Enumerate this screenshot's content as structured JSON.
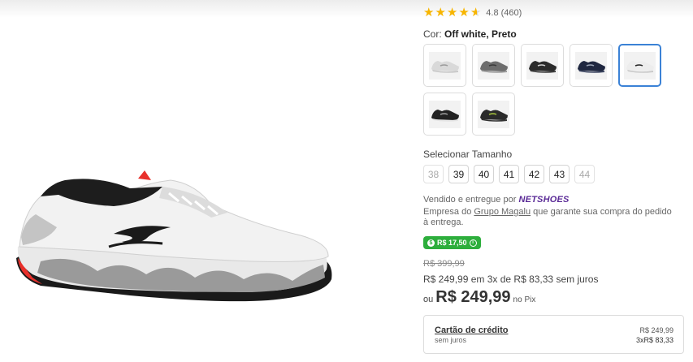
{
  "rating": {
    "value_text": "4.8 (460)",
    "stars": 4.5
  },
  "color": {
    "label": "Cor:",
    "value": "Off white, Preto"
  },
  "swatches": [
    {
      "name": "Off white, Cinza",
      "body": "#d9d9d9",
      "accent": "#9a9a9a",
      "sole": "#c8c8c8"
    },
    {
      "name": "Cinza escuro",
      "body": "#6d6d6d",
      "accent": "#3a3a3a",
      "sole": "#9a9a9a"
    },
    {
      "name": "Preto",
      "body": "#2b2b2b",
      "accent": "#cfcfcf",
      "sole": "#3a3a3a"
    },
    {
      "name": "Azul marinho",
      "body": "#1f2740",
      "accent": "#9aa3b5",
      "sole": "#3b4460"
    },
    {
      "name": "Off white, Preto",
      "body": "#ededed",
      "accent": "#222222",
      "sole": "#c9c9c9"
    },
    {
      "name": "Preto, Branco",
      "body": "#222222",
      "accent": "#9e9e9e",
      "sole": "#e6e6e6"
    },
    {
      "name": "Preto, Verde",
      "body": "#2a2a2a",
      "accent": "#a7c43d",
      "sole": "#333333"
    }
  ],
  "size_label": "Selecionar Tamanho",
  "sizes": [
    {
      "label": "38",
      "available": false
    },
    {
      "label": "39",
      "available": true
    },
    {
      "label": "40",
      "available": true
    },
    {
      "label": "41",
      "available": true
    },
    {
      "label": "42",
      "available": true
    },
    {
      "label": "43",
      "available": true
    },
    {
      "label": "44",
      "available": false
    }
  ],
  "seller": {
    "prefix": "Vendido e entregue por",
    "brand": "NETSHOES",
    "empresa_pre": "Empresa do",
    "empresa_link": "Grupo Magalu",
    "empresa_post": "que garante sua compra do pedido à entrega."
  },
  "cashback": {
    "text": "R$ 17,50",
    "icon": "cashback-icon",
    "info_icon": "info-icon"
  },
  "prices": {
    "old": "R$ 399,99",
    "installments": "R$ 249,99 em 3x de R$ 83,33 sem juros",
    "pix_prefix": "ou",
    "pix_price": "R$ 249,99",
    "pix_suffix": "no Pix"
  },
  "card": {
    "title": "Cartão de crédito",
    "subtitle": "sem juros",
    "value1": "R$ 249,99",
    "value2": "3xR$ 83,33"
  },
  "colors": {
    "star": "#f7b500",
    "cashback": "#2dae3c",
    "brand": "#5a2a96",
    "selected": "#3b82d6"
  }
}
